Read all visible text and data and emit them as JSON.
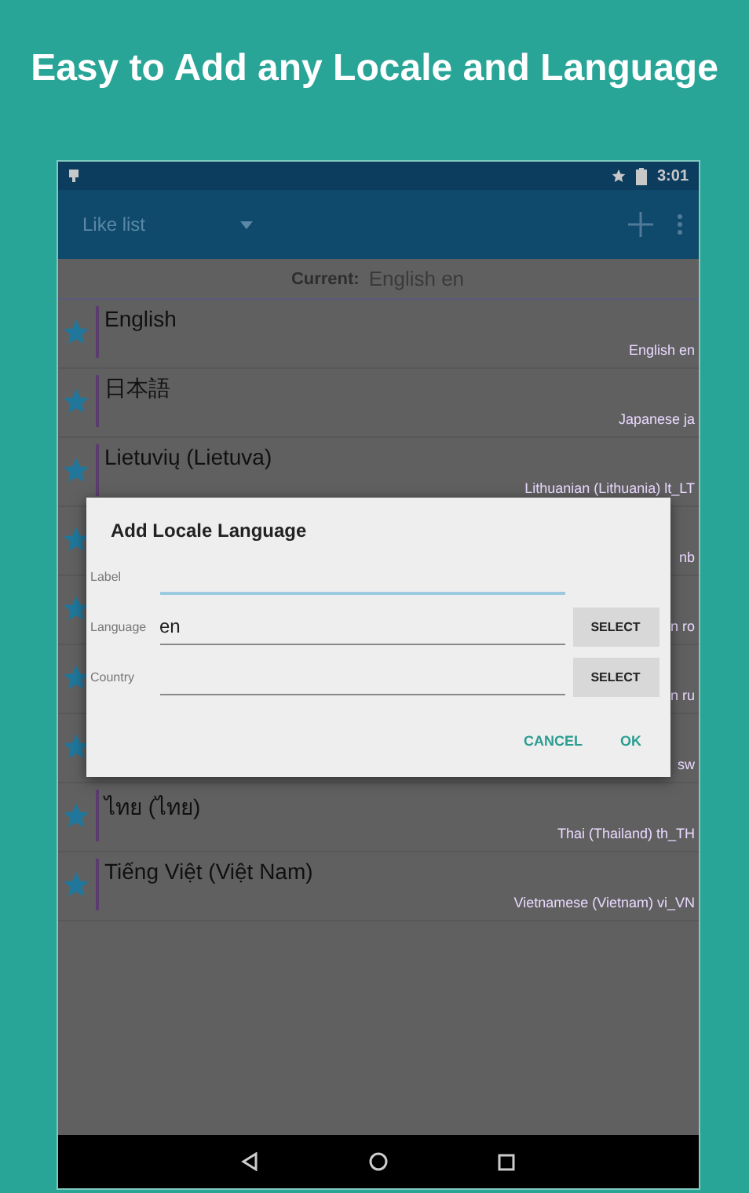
{
  "headline": "Easy to Add any Locale and Language",
  "status_bar": {
    "time": "3:01"
  },
  "toolbar": {
    "spinner_label": "Like list"
  },
  "current": {
    "label": "Current:",
    "value": "English en"
  },
  "rows": [
    {
      "title": "English",
      "subtitle": "English en"
    },
    {
      "title": "日本語",
      "subtitle": "Japanese ja"
    },
    {
      "title": "Lietuvių (Lietuva)",
      "subtitle": "Lithuanian (Lithuania) lt_LT"
    },
    {
      "subtitle": "nb"
    },
    {
      "subtitle": "n ro"
    },
    {
      "subtitle": "n ru"
    },
    {
      "subtitle": "sw"
    },
    {
      "title": "ไทย (ไทย)",
      "subtitle": "Thai (Thailand) th_TH"
    },
    {
      "title": "Tiếng Việt (Việt Nam)",
      "subtitle": "Vietnamese (Vietnam) vi_VN"
    }
  ],
  "dialog": {
    "title": "Add Locale Language",
    "fields": [
      {
        "label": "Label",
        "kind": "text",
        "focused": true
      },
      {
        "label": "Language",
        "value": "en",
        "kind": "select",
        "button": "SELECT",
        "focused": false
      },
      {
        "label": "Country",
        "kind": "select",
        "button": "SELECT",
        "focused": false
      }
    ],
    "buttons": [
      "CANCEL",
      "OK"
    ]
  }
}
